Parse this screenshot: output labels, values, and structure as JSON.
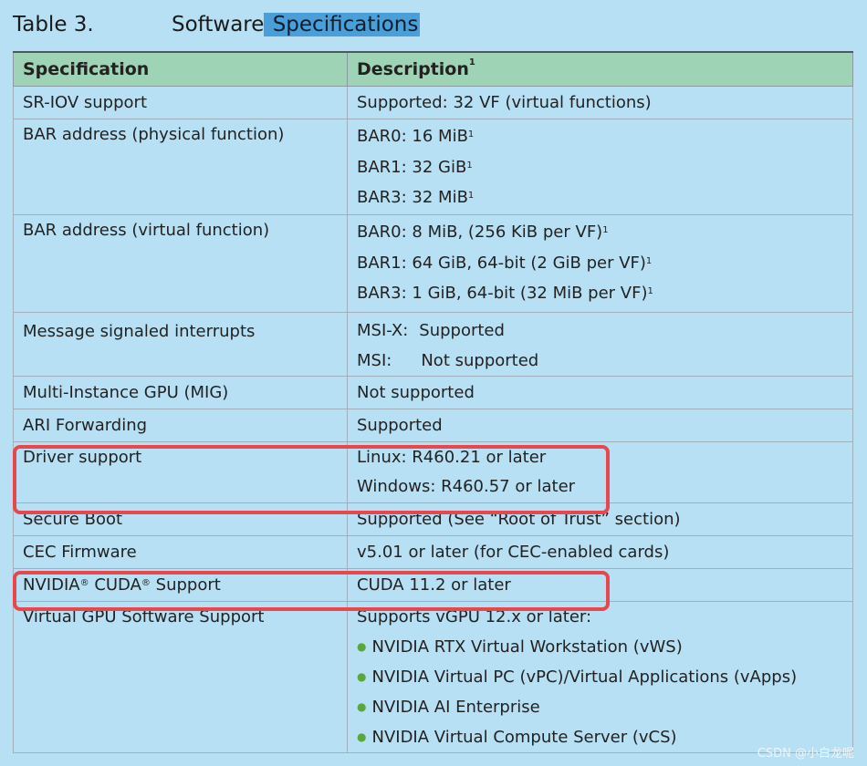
{
  "caption": {
    "number": "Table 3.",
    "title_plain": "Software",
    "title_selected": "Specifications"
  },
  "headers": {
    "spec": "Specification",
    "desc": "Description",
    "desc_sup": "1"
  },
  "rows": {
    "sriov": {
      "spec": "SR-IOV support",
      "desc": "Supported:  32 VF (virtual functions)"
    },
    "bar_pf": {
      "spec": "BAR address (physical function)",
      "lines": [
        "BAR0: 16 MiB",
        "BAR1: 32 GiB",
        "BAR3: 32 MiB"
      ],
      "sup": "1"
    },
    "bar_vf": {
      "spec": "BAR address (virtual function)",
      "lines": [
        "BAR0: 8 MiB, (256 KiB per VF)",
        "BAR1: 64 GiB, 64-bit (2 GiB per VF)",
        "BAR3: 1 GiB, 64-bit (32 MiB per VF)"
      ],
      "sup": "1"
    },
    "msi": {
      "spec": "Message signaled interrupts",
      "msix_label": "MSI-X:",
      "msix_value": "Supported",
      "msi_label": "MSI:",
      "msi_value": "Not supported"
    },
    "mig": {
      "spec": "Multi-Instance GPU (MIG)",
      "desc": "Not supported"
    },
    "ari": {
      "spec": "ARI Forwarding",
      "desc": "Supported"
    },
    "driver": {
      "spec": "Driver support",
      "linux": "Linux:  R460.21 or later",
      "windows": "Windows:  R460.57 or later"
    },
    "secure_boot": {
      "spec": "Secure Boot",
      "desc": "Supported (See “Root of Trust” section)"
    },
    "cec": {
      "spec": "CEC Firmware",
      "desc": "v5.01 or later (for CEC-enabled cards)"
    },
    "cuda": {
      "spec_a": "NVIDIA",
      "spec_b": "CUDA",
      "spec_c": "Support",
      "reg": "®",
      "desc": "CUDA 11.2 or later"
    },
    "vgpu": {
      "spec": "Virtual GPU Software Support",
      "intro": "Supports vGPU 12.x or later:",
      "bullet_glyph": "●",
      "items": [
        "NVIDIA RTX Virtual Workstation (vWS)",
        "NVIDIA Virtual PC (vPC)/Virtual Applications (vApps)",
        "NVIDIA AI Enterprise",
        "NVIDIA Virtual Compute Server (vCS)"
      ]
    }
  },
  "watermark": "CSDN @小白龙呢",
  "colors": {
    "background": "#b8e0f4",
    "header": "#9fd3b6",
    "highlight": "#e8474d",
    "bullet": "#5aa83a"
  }
}
